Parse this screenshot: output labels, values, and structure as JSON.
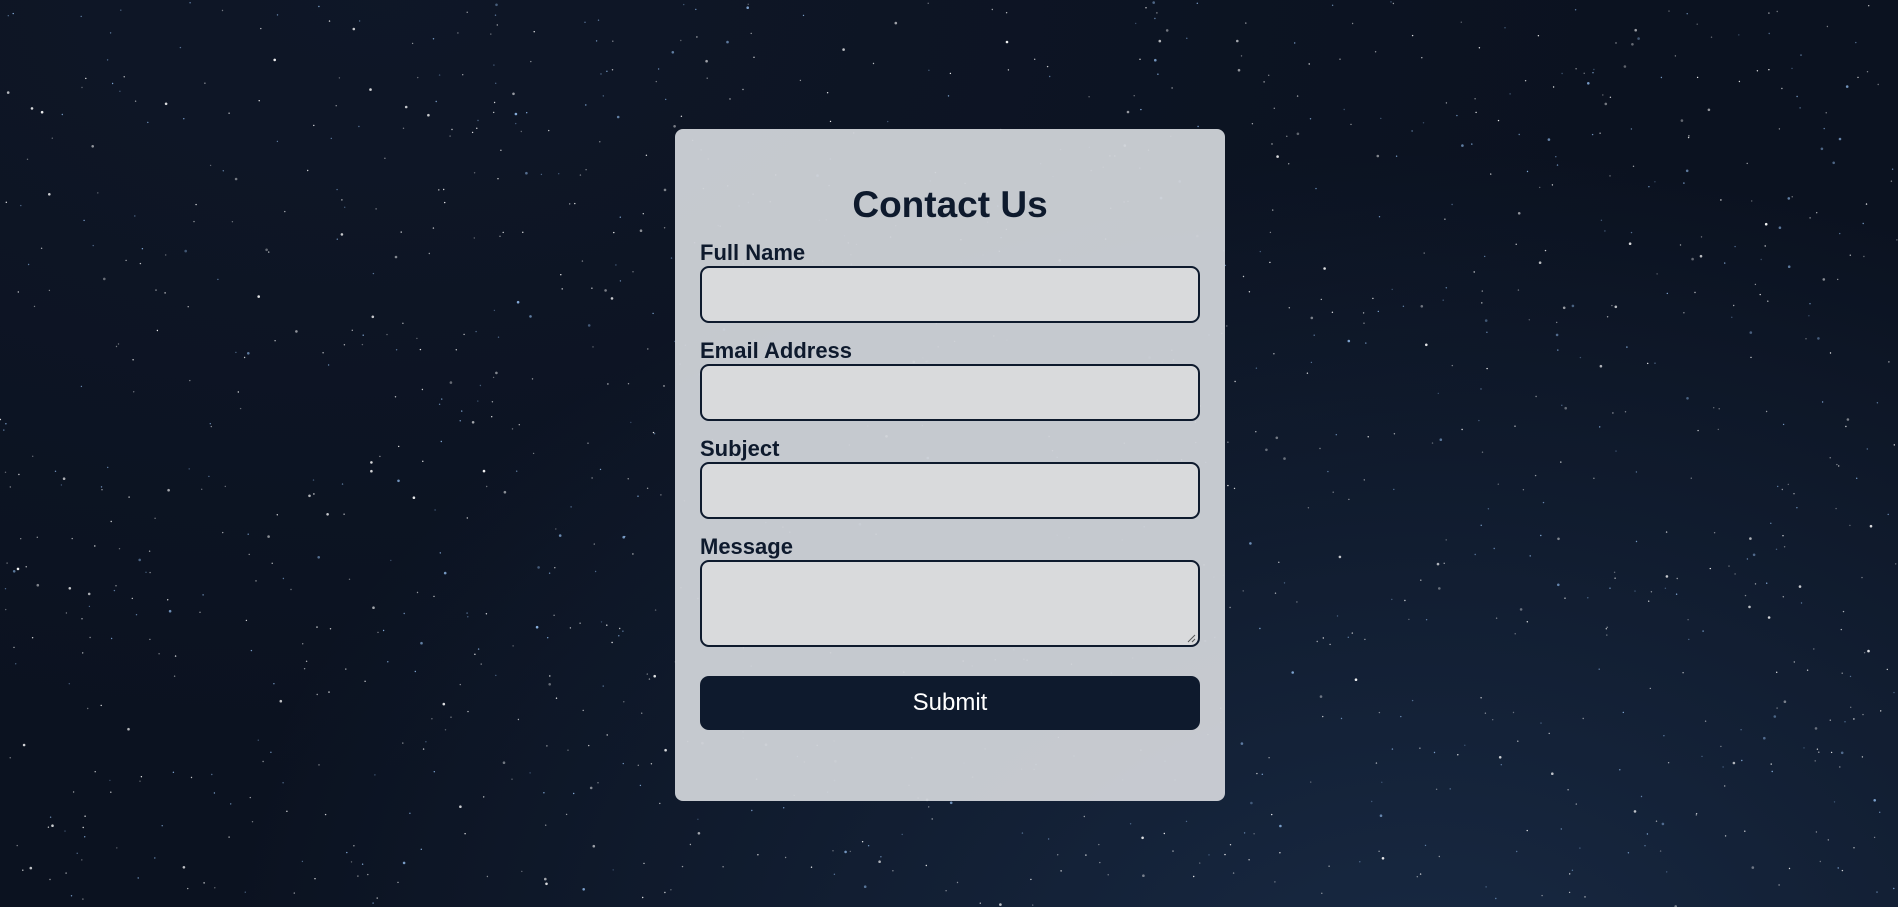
{
  "form": {
    "title": "Contact Us",
    "fields": [
      {
        "label": "Full Name",
        "value": "",
        "type": "text"
      },
      {
        "label": "Email Address",
        "value": "",
        "type": "email"
      },
      {
        "label": "Subject",
        "value": "",
        "type": "text"
      },
      {
        "label": "Message",
        "value": "",
        "type": "textarea"
      }
    ],
    "submit_label": "Submit"
  },
  "colors": {
    "background": "#0b1220",
    "card": "#d0d3d8",
    "text": "#0e1a2d",
    "button": "#0e1a2d",
    "button_text": "#ffffff"
  }
}
